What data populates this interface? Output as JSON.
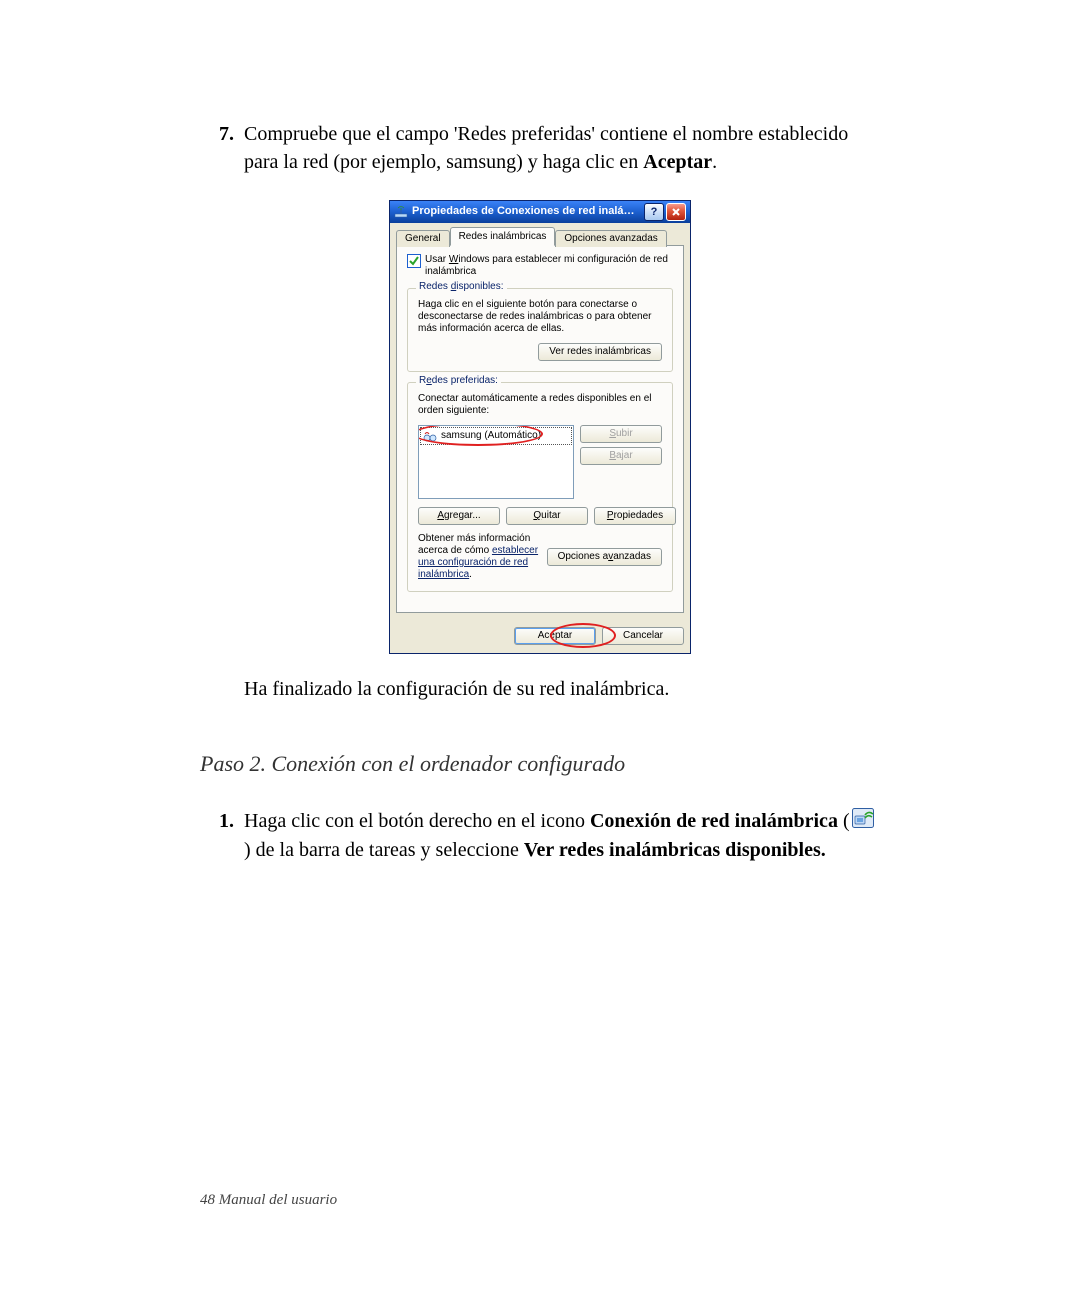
{
  "step7": {
    "number": "7.",
    "text_prefix": "Compruebe que el campo 'Redes preferidas' contiene el nombre establecido para la red (por ejemplo, samsung) y haga clic en ",
    "text_bold": "Aceptar",
    "text_suffix": "."
  },
  "dialog": {
    "title": "Propiedades de Conexiones de red inalámbricas",
    "help_btn": "?",
    "close_btn": "X",
    "tabs": {
      "general": "General",
      "wireless": "Redes inalámbricas",
      "advanced": "Opciones avanzadas"
    },
    "use_windows": {
      "prefix": "Usar ",
      "ukey": "W",
      "suffix": "indows para establecer mi configuración de red inalámbrica"
    },
    "available": {
      "legend_prefix": "Redes ",
      "legend_ukey": "d",
      "legend_suffix": "isponibles:",
      "text": "Haga clic en el siguiente botón para conectarse o desconectarse de redes inalámbricas o para obtener más información acerca de ellas.",
      "button": "Ver redes inalámbricas"
    },
    "preferred": {
      "legend_prefix": "R",
      "legend_ukey": "e",
      "legend_suffix": "des preferidas:",
      "text": "Conectar automáticamente a redes disponibles en el orden siguiente:",
      "item": "samsung (Automático)",
      "up_ukey": "S",
      "up_label": "ubir",
      "down_ukey": "B",
      "down_label": "ajar",
      "add_ukey": "A",
      "add_label": "gregar...",
      "remove_ukey": "Q",
      "remove_label": "uitar",
      "props_ukey": "P",
      "props_label": "ropiedades"
    },
    "info": {
      "text": "Obtener más información acerca de cómo ",
      "link": "establecer una configuración de red inalámbrica",
      "link_suffix": ".",
      "adv_prefix": "Opciones a",
      "adv_ukey": "v",
      "adv_suffix": "anzadas"
    },
    "footer": {
      "ok": "Aceptar",
      "cancel": "Cancelar"
    }
  },
  "followup": "Ha finalizado la configuración de su red inalámbrica.",
  "section_heading": "Paso 2. Conexión con el ordenador configurado",
  "step1": {
    "number": "1.",
    "p1_prefix": "Haga clic con el botón derecho en el icono ",
    "p1_bold": "Conexión de red inalámbrica",
    "p1_mid": " (",
    "p1_tail": ") de la barra de tareas y seleccione ",
    "p1_bold2": "Ver redes inalámbricas disponibles."
  },
  "footer_text": "48  Manual del usuario"
}
